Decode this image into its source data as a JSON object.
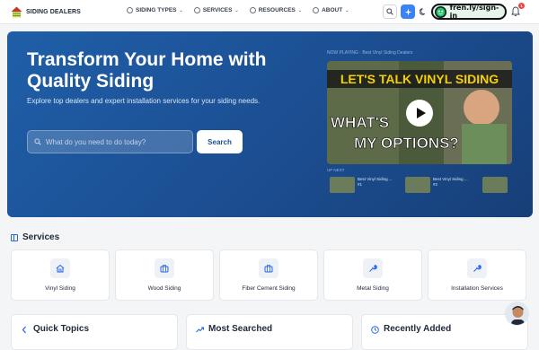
{
  "brand": {
    "name": "SIDING DEALERS"
  },
  "nav": [
    {
      "label": "SIDING TYPES",
      "icon": "question-circle-icon"
    },
    {
      "label": "SERVICES",
      "icon": "question-circle-icon"
    },
    {
      "label": "RESOURCES",
      "icon": "question-circle-icon"
    },
    {
      "label": "ABOUT",
      "icon": "question-circle-icon"
    }
  ],
  "toolbar": {
    "signin_label": "fren.ly/sign-in",
    "notification_count": "1"
  },
  "hero": {
    "title": "Transform Your Home with Quality Siding",
    "subtitle": "Explore top dealers and expert installation services for your siding needs.",
    "search_placeholder": "What do you need to do today?",
    "search_button": "Search",
    "video_label": "NOW PLAYING · Best Vinyl Siding Dealers",
    "video_headline_1": "LET'S TALK VINYL SIDING",
    "video_headline_2": "WHAT'S",
    "video_headline_3": "MY OPTIONS?",
    "playlist_label": "UP NEXT",
    "playlist": [
      {
        "title": "Best Vinyl Siding ...",
        "meta": "#1"
      },
      {
        "title": "Best Vinyl Siding ...",
        "meta": "#2"
      },
      {
        "title": "",
        "meta": ""
      }
    ]
  },
  "services": {
    "title": "Services",
    "items": [
      {
        "label": "Vinyl Siding",
        "icon": "home-icon"
      },
      {
        "label": "Wood Siding",
        "icon": "briefcase-icon"
      },
      {
        "label": "Fiber Cement Siding",
        "icon": "briefcase-icon"
      },
      {
        "label": "Metal Siding",
        "icon": "wrench-icon"
      },
      {
        "label": "Installation Services",
        "icon": "wrench-icon"
      }
    ]
  },
  "panels": [
    {
      "title": "Quick Topics",
      "icon": "chevron-icon"
    },
    {
      "title": "Most Searched",
      "icon": "trending-icon"
    },
    {
      "title": "Recently Added",
      "icon": "clock-icon"
    }
  ],
  "colors": {
    "accent": "#2563eb",
    "hero": "#1c4f93",
    "badge": "#ef4444"
  }
}
